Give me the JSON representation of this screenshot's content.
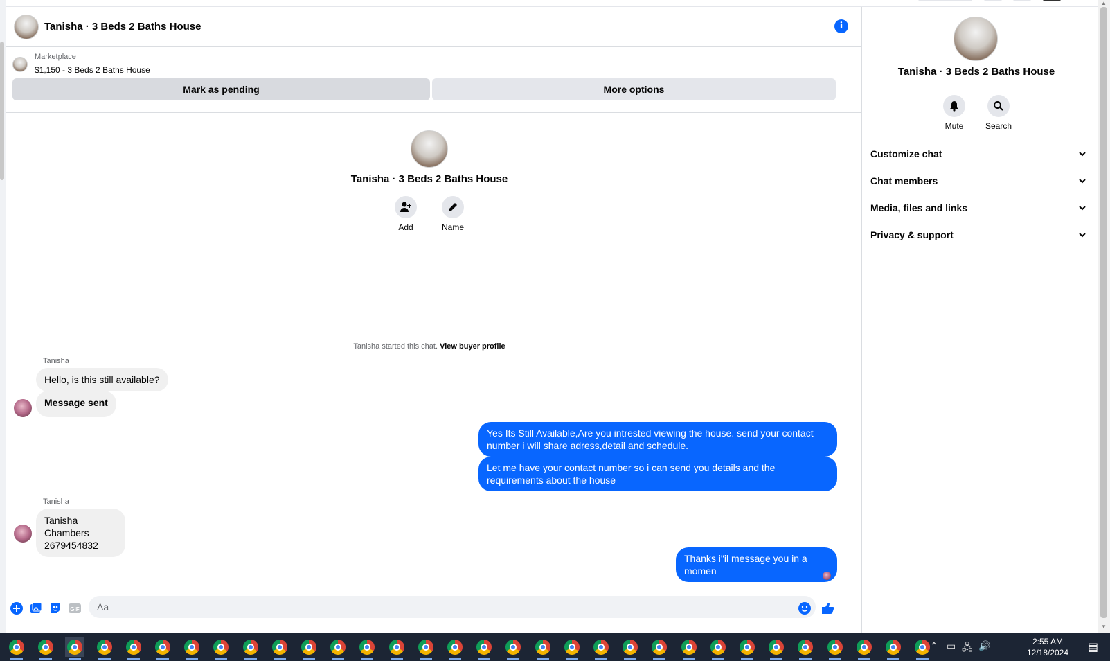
{
  "header": {
    "title": "Tanisha · 3 Beds 2 Baths House",
    "info_icon": "info-icon",
    "info_glyph": "i"
  },
  "listing": {
    "source": "Marketplace",
    "title": "$1,150 - 3 Beds 2 Baths House",
    "mark_pending_label": "Mark as pending",
    "more_options_label": "More options"
  },
  "intro": {
    "name": "Tanisha · 3 Beds 2 Baths House",
    "add_label": "Add",
    "name_label": "Name",
    "started_text": "Tanisha started this chat.",
    "view_profile_link": "View buyer profile"
  },
  "messages": [
    {
      "sender": "Tanisha",
      "direction": "in",
      "text": "Hello, is this still available?"
    },
    {
      "direction": "in",
      "text": "Message sent"
    },
    {
      "direction": "out",
      "text": "Yes Its Still Available,Are you intrested viewing the house. send your contact number i will share adress,detail and schedule."
    },
    {
      "direction": "out",
      "text": "Let me have your contact number so i can send you details and the requirements about the house"
    },
    {
      "sender": "Tanisha",
      "direction": "in",
      "line1": "Tanisha Chambers",
      "line2": "2679454832"
    },
    {
      "direction": "out",
      "text": "Thanks i\"il message you in a momen"
    }
  ],
  "composer": {
    "placeholder": "Aa",
    "gif_label": "GIF",
    "accent": "#0866ff"
  },
  "side_panel": {
    "title": "Tanisha · 3 Beds 2 Baths House",
    "mute_label": "Mute",
    "search_label": "Search",
    "sections": [
      "Customize chat",
      "Chat members",
      "Media, files and links",
      "Privacy & support"
    ]
  },
  "taskbar": {
    "time": "2:55 AM",
    "date": "12/18/2024",
    "app_icon": "chrome-icon"
  },
  "colors": {
    "accent": "#0866ff",
    "incoming_bubble": "#f0f0f0",
    "taskbar": "#1c2534"
  }
}
